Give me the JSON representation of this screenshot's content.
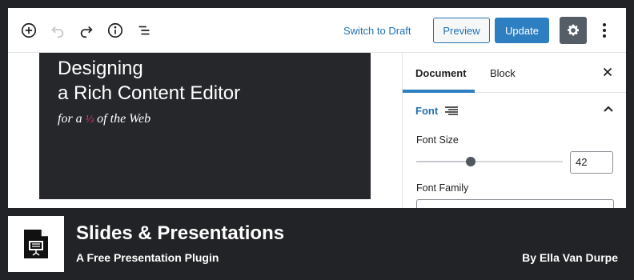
{
  "toolbar": {
    "add_icon": "plus-circle-icon",
    "undo_icon": "undo-icon",
    "redo_icon": "redo-icon",
    "info_icon": "info-icon",
    "outline_icon": "list-view-icon",
    "switch_to_draft": "Switch to Draft",
    "preview": "Preview",
    "update": "Update",
    "settings_icon": "gear-icon",
    "more_icon": "more-vertical-icon"
  },
  "slide": {
    "title_line1": "Designing",
    "title_line2": "a Rich Content Editor",
    "sub_before": "for a",
    "sub_fraction": "⅓",
    "sub_after": "of the Web"
  },
  "sidebar": {
    "tab_document": "Document",
    "tab_block": "Block",
    "panel_title": "Font",
    "font_size_label": "Font Size",
    "font_size_value": "42",
    "font_size_slider_fraction": 0.37,
    "font_family_label": "Font Family"
  },
  "plugin": {
    "title": "Slides & Presentations",
    "subtitle": "A Free Presentation Plugin",
    "author": "By Ella Van Durpe"
  },
  "colors": {
    "accent": "#2e7ec2",
    "link": "#2271b1",
    "slide_bg": "#25272b",
    "fraction": "#e23a65",
    "background": "#222326"
  }
}
